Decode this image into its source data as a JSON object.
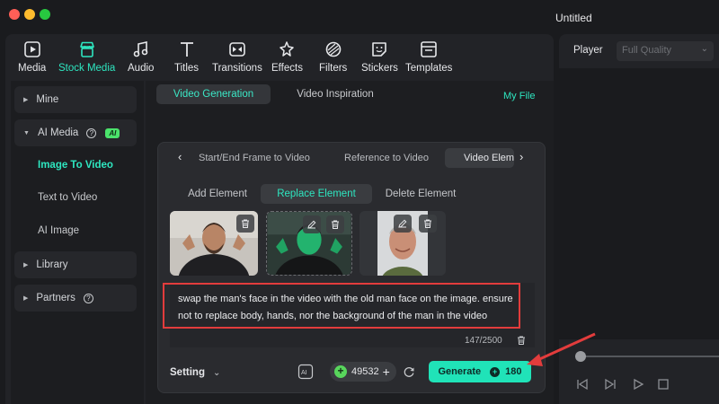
{
  "window": {
    "title": "Untitled"
  },
  "toolbar": {
    "items": [
      {
        "label": "Media",
        "icon": "media-icon"
      },
      {
        "label": "Stock Media",
        "icon": "stock-media-icon",
        "active": true
      },
      {
        "label": "Audio",
        "icon": "audio-icon"
      },
      {
        "label": "Titles",
        "icon": "titles-icon"
      },
      {
        "label": "Transitions",
        "icon": "transitions-icon"
      },
      {
        "label": "Effects",
        "icon": "effects-icon"
      },
      {
        "label": "Filters",
        "icon": "filters-icon"
      },
      {
        "label": "Stickers",
        "icon": "stickers-icon"
      },
      {
        "label": "Templates",
        "icon": "templates-icon"
      }
    ]
  },
  "sidebar": {
    "mine": "Mine",
    "ai_media": "AI Media",
    "ai_badge": "AI",
    "sub_items": [
      "Image To Video",
      "Text to Video",
      "AI Image"
    ],
    "library": "Library",
    "partners": "Partners"
  },
  "main": {
    "tabs": [
      "Video Generation",
      "Video Inspiration"
    ],
    "my_file": "My File"
  },
  "card": {
    "mode_tabs": [
      "Start/End Frame to Video",
      "Reference to Video",
      "Video Elem"
    ],
    "sub_tabs": [
      "Add Element",
      "Replace Element",
      "Delete Element"
    ],
    "prompt": "swap the man's face in the video with the old man face on the image. ensure not to replace body, hands, nor the background of the man in the video",
    "counter": "147/2500",
    "setting_label": "Setting",
    "credits": "49532",
    "generate_label": "Generate",
    "generate_cost": "180"
  },
  "player": {
    "label": "Player",
    "quality": "Full Quality"
  },
  "colors": {
    "accent": "#2ee6c0",
    "generate_bg": "#20e3b8",
    "highlight": "#e23c3c"
  }
}
